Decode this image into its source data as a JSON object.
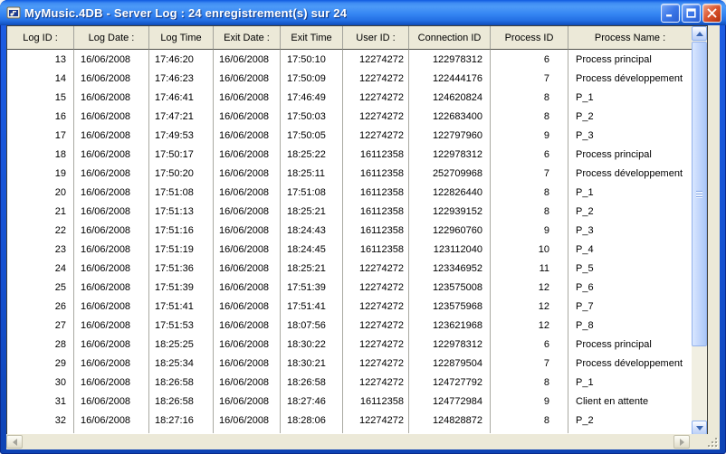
{
  "window": {
    "title": "MyMusic.4DB - Server Log :  24 enregistrement(s) sur 24"
  },
  "table": {
    "columns": [
      {
        "key": "log-id",
        "label": "Log ID :"
      },
      {
        "key": "log-date",
        "label": "Log Date :"
      },
      {
        "key": "log-time",
        "label": "Log Time"
      },
      {
        "key": "exit-date",
        "label": "Exit Date :"
      },
      {
        "key": "exit-time",
        "label": "Exit Time"
      },
      {
        "key": "user-id",
        "label": "User ID :"
      },
      {
        "key": "connection-id",
        "label": "Connection ID"
      },
      {
        "key": "process-id",
        "label": "Process ID"
      },
      {
        "key": "process-name",
        "label": "Process Name :"
      }
    ],
    "rows": [
      [
        "13",
        "16/06/2008",
        "17:46:20",
        "16/06/2008",
        "17:50:10",
        "12274272",
        "122978312",
        "6",
        "Process principal"
      ],
      [
        "14",
        "16/06/2008",
        "17:46:23",
        "16/06/2008",
        "17:50:09",
        "12274272",
        "122444176",
        "7",
        "Process développement"
      ],
      [
        "15",
        "16/06/2008",
        "17:46:41",
        "16/06/2008",
        "17:46:49",
        "12274272",
        "124620824",
        "8",
        "P_1"
      ],
      [
        "16",
        "16/06/2008",
        "17:47:21",
        "16/06/2008",
        "17:50:03",
        "12274272",
        "122683400",
        "8",
        "P_2"
      ],
      [
        "17",
        "16/06/2008",
        "17:49:53",
        "16/06/2008",
        "17:50:05",
        "12274272",
        "122797960",
        "9",
        "P_3"
      ],
      [
        "18",
        "16/06/2008",
        "17:50:17",
        "16/06/2008",
        "18:25:22",
        "16112358",
        "122978312",
        "6",
        "Process principal"
      ],
      [
        "19",
        "16/06/2008",
        "17:50:20",
        "16/06/2008",
        "18:25:11",
        "16112358",
        "252709968",
        "7",
        "Process développement"
      ],
      [
        "20",
        "16/06/2008",
        "17:51:08",
        "16/06/2008",
        "17:51:08",
        "16112358",
        "122826440",
        "8",
        "P_1"
      ],
      [
        "21",
        "16/06/2008",
        "17:51:13",
        "16/06/2008",
        "18:25:21",
        "16112358",
        "122939152",
        "8",
        "P_2"
      ],
      [
        "22",
        "16/06/2008",
        "17:51:16",
        "16/06/2008",
        "18:24:43",
        "16112358",
        "122960760",
        "9",
        "P_3"
      ],
      [
        "23",
        "16/06/2008",
        "17:51:19",
        "16/06/2008",
        "18:24:45",
        "16112358",
        "123112040",
        "10",
        "P_4"
      ],
      [
        "24",
        "16/06/2008",
        "17:51:36",
        "16/06/2008",
        "18:25:21",
        "12274272",
        "123346952",
        "11",
        "P_5"
      ],
      [
        "25",
        "16/06/2008",
        "17:51:39",
        "16/06/2008",
        "17:51:39",
        "12274272",
        "123575008",
        "12",
        "P_6"
      ],
      [
        "26",
        "16/06/2008",
        "17:51:41",
        "16/06/2008",
        "17:51:41",
        "12274272",
        "123575968",
        "12",
        "P_7"
      ],
      [
        "27",
        "16/06/2008",
        "17:51:53",
        "16/06/2008",
        "18:07:56",
        "12274272",
        "123621968",
        "12",
        "P_8"
      ],
      [
        "28",
        "16/06/2008",
        "18:25:25",
        "16/06/2008",
        "18:30:22",
        "12274272",
        "122978312",
        "6",
        "Process principal"
      ],
      [
        "29",
        "16/06/2008",
        "18:25:34",
        "16/06/2008",
        "18:30:21",
        "12274272",
        "122879504",
        "7",
        "Process développement"
      ],
      [
        "30",
        "16/06/2008",
        "18:26:58",
        "16/06/2008",
        "18:26:58",
        "12274272",
        "124727792",
        "8",
        "P_1"
      ],
      [
        "31",
        "16/06/2008",
        "18:26:58",
        "16/06/2008",
        "18:27:46",
        "16112358",
        "124772984",
        "9",
        "Client en attente"
      ],
      [
        "32",
        "16/06/2008",
        "18:27:16",
        "16/06/2008",
        "18:28:06",
        "12274272",
        "124828872",
        "8",
        "P_2"
      ]
    ]
  },
  "colors": {
    "titlebar_blue": "#3586f3",
    "window_border_blue": "#1450cf",
    "chrome_beige": "#ece9d8",
    "table_bg": "#ffffff",
    "grid_line": "#a9a9a1",
    "close_red": "#c43d18",
    "scrollbar_thumb": "#c4d8fc"
  }
}
